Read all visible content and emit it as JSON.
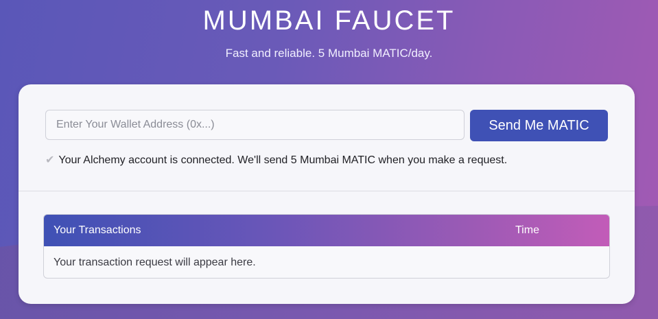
{
  "hero": {
    "title": "MUMBAI FAUCET",
    "subtitle": "Fast and reliable. 5 Mumbai MATIC/day."
  },
  "form": {
    "address_placeholder": "Enter Your Wallet Address (0x...)",
    "address_value": "",
    "send_label": "Send Me MATIC",
    "status_icon": "check-icon",
    "status_icon_glyph": "✔",
    "status_text": "Your Alchemy account is connected. We'll send 5 Mumbai MATIC when you make a request."
  },
  "transactions": {
    "header_main": "Your Transactions",
    "header_time": "Time",
    "empty_message": "Your transaction request will appear here."
  },
  "colors": {
    "button": "#3f51b5",
    "header_gradient_start": "#3f51b5",
    "header_gradient_end": "#c25cb8",
    "card": "#f6f6fa"
  }
}
